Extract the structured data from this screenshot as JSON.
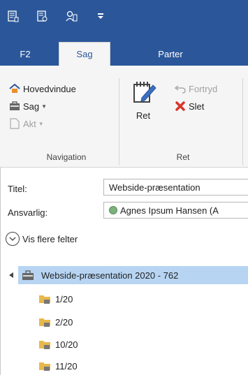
{
  "tabs": [
    {
      "label": "F2"
    },
    {
      "label": "Sag"
    },
    {
      "label": "Parter"
    }
  ],
  "ribbon": {
    "hovedvindue": "Hovedvindue",
    "sag": "Sag",
    "akt": "Akt",
    "ret_big": "Ret",
    "fortryd": "Fortryd",
    "slet": "Slet",
    "group_navigation": "Navigation",
    "group_ret": "Ret"
  },
  "form": {
    "titel_label": "Titel:",
    "titel_value": "Webside-præsentation",
    "ansvarlig_label": "Ansvarlig:",
    "ansvarlig_value": "Agnes Ipsum Hansen (A",
    "more_fields": "Vis flere felter"
  },
  "tree": {
    "root": "Webside-præsentation 2020 - 762",
    "children": [
      "1/20",
      "2/20",
      "10/20",
      "11/20"
    ]
  },
  "colors": {
    "brand": "#2b579a",
    "ribbon_bg": "#f5f5f5",
    "selection": "#b7d5f3",
    "delete_red": "#d9342b",
    "folder": "#e8b84a"
  }
}
